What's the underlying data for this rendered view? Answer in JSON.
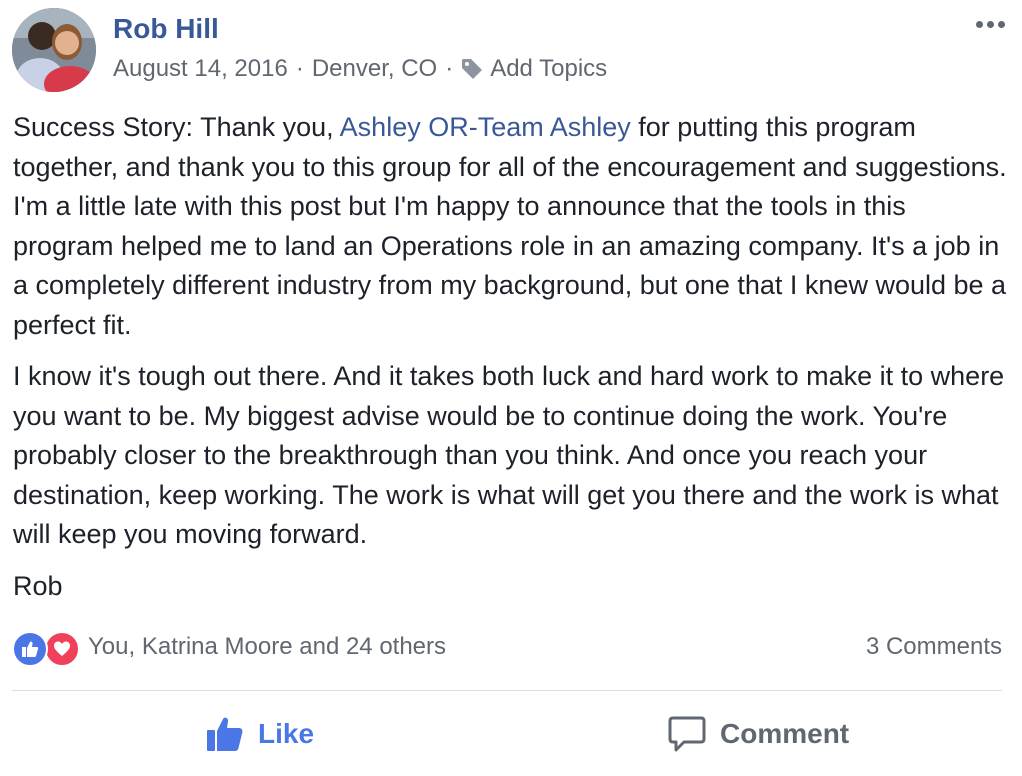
{
  "post": {
    "author": {
      "name": "Rob Hill"
    },
    "meta": {
      "date": "August 14, 2016",
      "separator": "·",
      "location": "Denver, CO",
      "add_topics_label": "Add Topics"
    },
    "body": {
      "p1_before": "Success Story: Thank you, ",
      "p1_mention": "Ashley OR-Team Ashley",
      "p1_after": " for putting this program together, and thank you to this group for all of the encouragement and suggestions. I'm a little late with this post but I'm happy to announce that the tools in this program helped me to land an Operations role in an amazing company. It's a job in a completely different industry from my background, but one that I knew would be a perfect fit.",
      "p2": "I know it's tough out there. And it takes both luck and hard work to make it to where you want to be. My biggest advise would be to continue doing the work. You're probably closer to the breakthrough than you think. And once you reach your destination, keep working. The work is what will get you there and the work is what will keep you moving forward.",
      "p3": "Rob"
    },
    "reactions": {
      "text": "You, Katrina Moore and 24 others",
      "types": [
        "like",
        "love"
      ]
    },
    "comments_label": "3 Comments",
    "actions": {
      "like_label": "Like",
      "comment_label": "Comment"
    },
    "colors": {
      "link": "#385898",
      "meta": "#616770",
      "like_blue": "#4a76e6",
      "love_red": "#f0405a"
    },
    "icons": {
      "more": "more-options-icon",
      "tag": "tag-icon",
      "like": "thumbs-up-icon",
      "love": "heart-icon",
      "comment": "speech-bubble-icon"
    }
  }
}
